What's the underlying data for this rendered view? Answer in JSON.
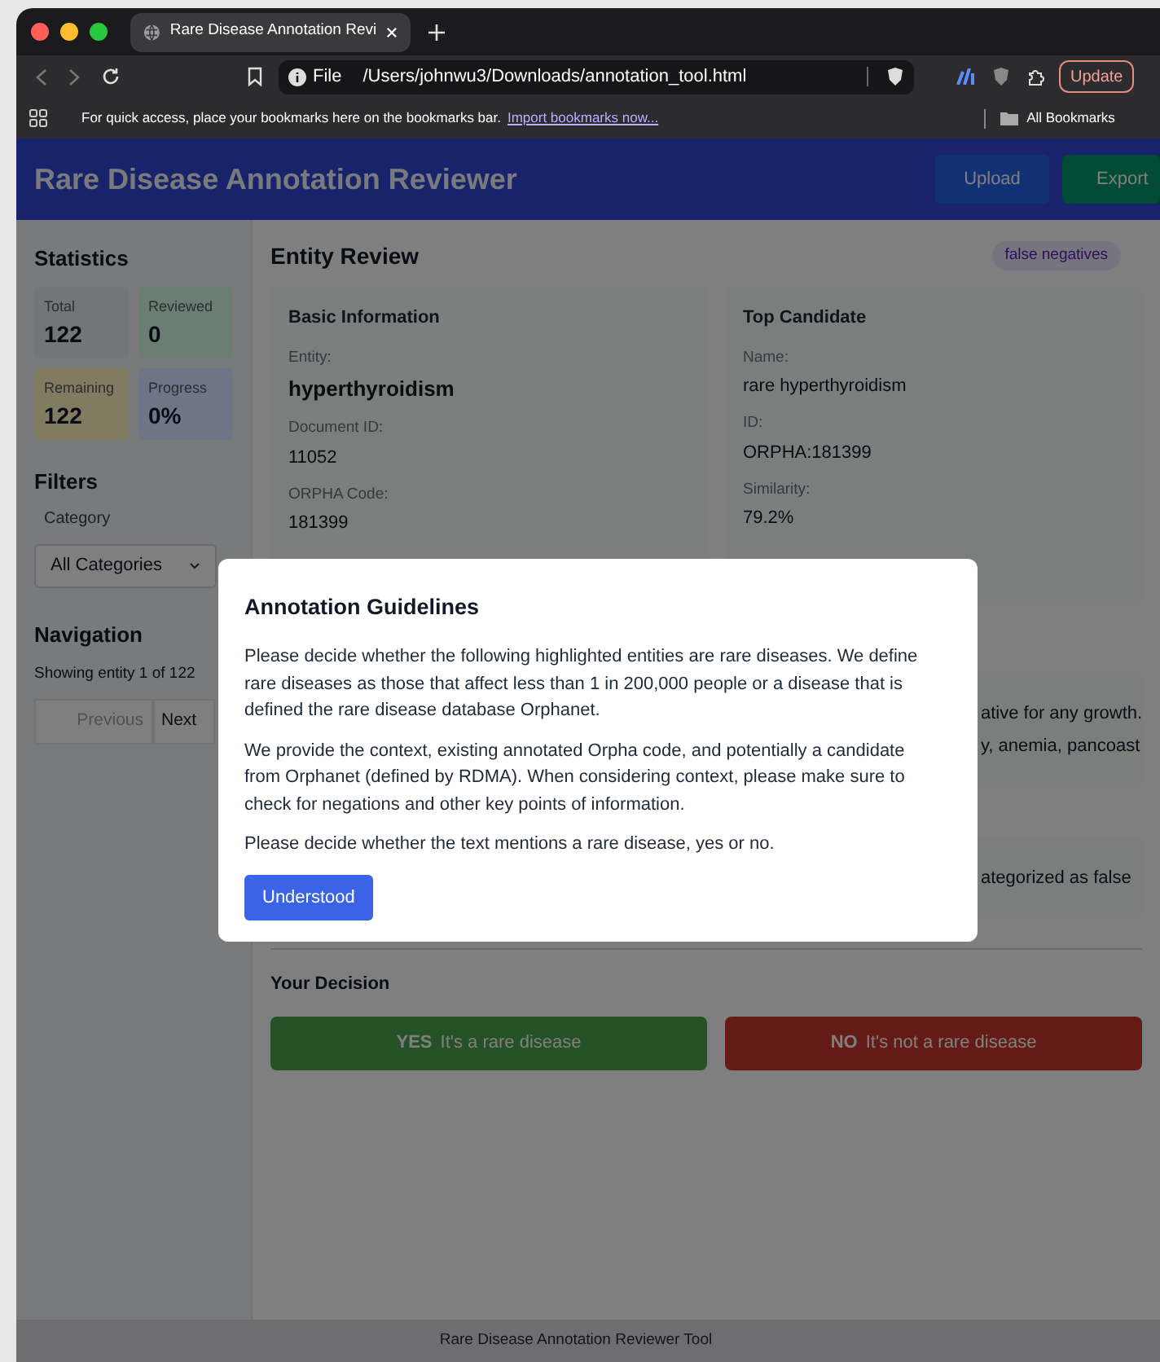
{
  "browser": {
    "tab_title": "Rare Disease Annotation Revi",
    "address_scheme": "File",
    "address": "/Users/johnwu3/Downloads/annotation_tool.html",
    "update_button": "Update",
    "bookmarks_hint": "For quick access, place your bookmarks here on the bookmarks bar.",
    "import_link": "Import bookmarks now...",
    "all_bookmarks": "All Bookmarks"
  },
  "header": {
    "title": "Rare Disease Annotation Reviewer",
    "buttons": [
      {
        "kind": "upload",
        "label": "Upload"
      },
      {
        "kind": "export",
        "label": "Export"
      }
    ]
  },
  "sidebar": {
    "statistics_title": "Statistics",
    "stats": [
      {
        "label": "Total",
        "value": "122",
        "color": "#737579"
      },
      {
        "label": "Reviewed",
        "value": "0",
        "color": "#6c7e73"
      },
      {
        "label": "Remaining",
        "value": "122",
        "color": "#817b62"
      },
      {
        "label": "Progress",
        "value": "0%",
        "color": "#6e7586"
      }
    ],
    "filters_title": "Filters",
    "category_label": "Category",
    "category_select": "All Categories",
    "navigation_title": "Navigation",
    "position": "Showing entity 1 of 122",
    "nav_buttons": [
      {
        "label": "Previous",
        "disabled": true
      },
      {
        "label": "Next",
        "disabled": false
      }
    ]
  },
  "main": {
    "title": "Entity Review",
    "category_badge": "false negatives",
    "basic_info": {
      "title": "Basic Information",
      "fields": [
        {
          "kind": "emphasis",
          "label": "Entity:",
          "value": "hyperthyroidism"
        },
        {
          "kind": "plain",
          "label": "Document ID:",
          "value": "11052"
        },
        {
          "kind": "plain",
          "label": "ORPHA Code:",
          "value": "181399"
        }
      ]
    },
    "top_candidate": {
      "title": "Top Candidate",
      "fields": [
        {
          "kind": "plain",
          "label": "Name:",
          "value": "rare hyperthyroidism"
        },
        {
          "kind": "plain",
          "label": "ID:",
          "value": "ORPHA:181399"
        },
        {
          "kind": "plain",
          "label": "Similarity:",
          "value": "79.2%"
        }
      ]
    },
    "context_fragments": [
      "ative for any growth.",
      "y, anemia, pancoast"
    ],
    "notes_fragment": "ategorized as false",
    "decision": {
      "title": "Your Decision",
      "buttons": [
        {
          "kind": "yes",
          "key": "YES",
          "label": "It's a rare disease"
        },
        {
          "kind": "no",
          "key": "NO",
          "label": "It's not a rare disease"
        }
      ]
    }
  },
  "footer": "Rare Disease Annotation Reviewer Tool",
  "dialog": {
    "title": "Annotation Guidelines",
    "paragraphs": [
      "Please decide whether the following highlighted entities are rare diseases. We define rare diseases as those that affect less than 1 in 200,000 people or a disease that is defined the rare disease database Orphanet.",
      "We provide the context, existing annotated Orpha code, and potentially a candidate from Orphanet (defined by RDMA). When considering context, please make sure to check for negations and other key points of information.",
      "Please decide whether the text mentions a rare disease, yes or no."
    ],
    "button": "Understood"
  }
}
